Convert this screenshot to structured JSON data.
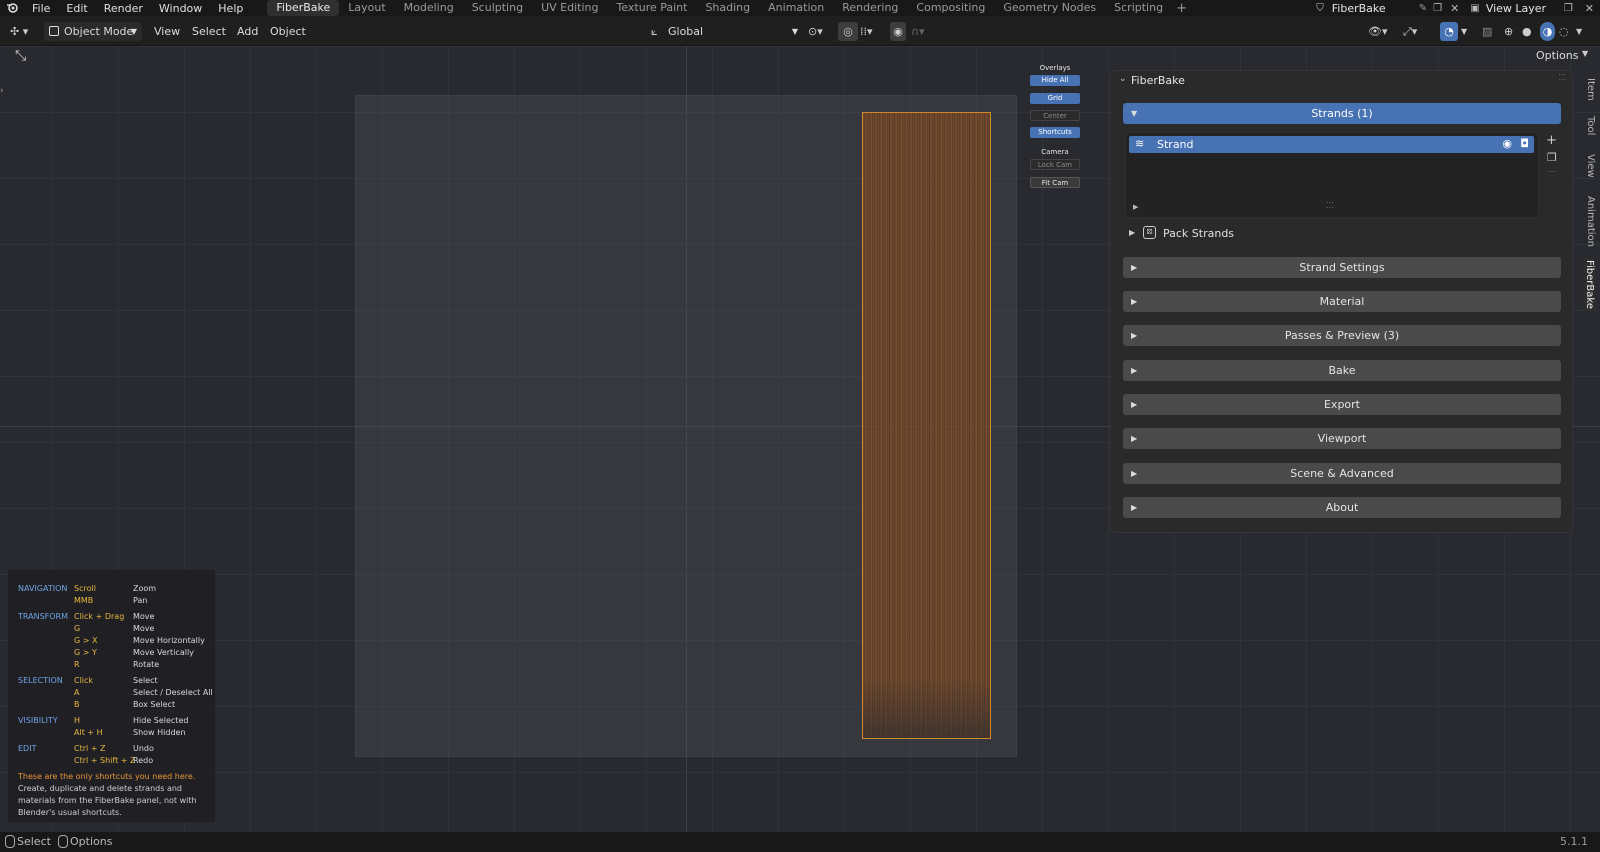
{
  "menu": [
    "File",
    "Edit",
    "Render",
    "Window",
    "Help"
  ],
  "workspaces": [
    "FiberBake",
    "Layout",
    "Modeling",
    "Sculpting",
    "UV Editing",
    "Texture Paint",
    "Shading",
    "Animation",
    "Rendering",
    "Compositing",
    "Geometry Nodes",
    "Scripting"
  ],
  "active_workspace": "FiberBake",
  "scene_name": "FiberBake",
  "view_layer": "View Layer",
  "header": {
    "mode": "Object Mode",
    "view": "View",
    "select": "Select",
    "add": "Add",
    "object": "Object",
    "orientation": "Global",
    "options": "Options"
  },
  "overlays": {
    "title": "Overlays",
    "hide_all": "Hide All",
    "grid": "Grid",
    "center": "Center",
    "shortcuts": "Shortcuts",
    "camera_title": "Camera",
    "lock_cam": "Lock Cam",
    "fit_cam": "Fit Cam"
  },
  "panel": {
    "title": "FiberBake",
    "strands_header": "Strands  (1)",
    "strand_item": "Strand",
    "pack_strands": "Pack Strands",
    "sections": [
      "Strand Settings",
      "Material",
      "Passes & Preview  (3)",
      "Bake",
      "Export",
      "Viewport",
      "Scene & Advanced",
      "About"
    ]
  },
  "side_tabs": [
    "Item",
    "Tool",
    "View",
    "Animation",
    "FiberBake"
  ],
  "help": {
    "rows": [
      {
        "c1": "NAVIGATION",
        "c2": "Scroll",
        "c3": "Zoom"
      },
      {
        "c1": "",
        "c2": "MMB",
        "c3": "Pan"
      },
      {
        "c1": "TRANSFORM",
        "c2": "Click + Drag",
        "c3": "Move"
      },
      {
        "c1": "",
        "c2": "G",
        "c3": "Move"
      },
      {
        "c1": "",
        "c2": "G  >  X",
        "c3": "Move Horizontally"
      },
      {
        "c1": "",
        "c2": "G  >  Y",
        "c3": "Move Vertically"
      },
      {
        "c1": "",
        "c2": "R",
        "c3": "Rotate"
      },
      {
        "c1": "SELECTION",
        "c2": "Click",
        "c3": "Select"
      },
      {
        "c1": "",
        "c2": "A",
        "c3": "Select / Deselect All"
      },
      {
        "c1": "",
        "c2": "B",
        "c3": "Box Select"
      },
      {
        "c1": "VISIBILITY",
        "c2": "H",
        "c3": "Hide Selected"
      },
      {
        "c1": "",
        "c2": "Alt + H",
        "c3": "Show Hidden"
      },
      {
        "c1": "EDIT",
        "c2": "Ctrl + Z",
        "c3": "Undo"
      },
      {
        "c1": "",
        "c2": "Ctrl + Shift + Z",
        "c3": "Redo"
      }
    ],
    "note_orange": "These are the only shortcuts you need here.",
    "note_lines": [
      "Create, duplicate and delete strands and",
      "materials from the FiberBake panel, not with",
      "Blender's usual shortcuts."
    ]
  },
  "status": {
    "select": "Select",
    "options": "Options",
    "version": "5.1.1"
  },
  "colors": {
    "accent": "#4772b3",
    "strand_outline": "#d4882c",
    "help_section": "#6ea3e6",
    "help_key": "#e8b640",
    "note": "#e8943a"
  }
}
